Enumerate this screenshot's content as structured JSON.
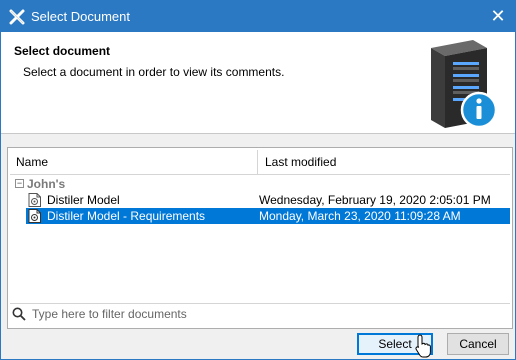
{
  "window": {
    "title": "Select Document",
    "close_glyph": "✕"
  },
  "header": {
    "title": "Select document",
    "description": "Select a document in order to view its comments."
  },
  "table": {
    "columns": [
      "Name",
      "Last modified"
    ],
    "group": {
      "label": "John's",
      "expander_glyph": "−"
    },
    "rows": [
      {
        "name": "Distiler Model",
        "modified": "Wednesday, February 19, 2020 2:05:01 PM",
        "selected": false
      },
      {
        "name": "Distiler Model - Requirements",
        "modified": "Monday, March 23, 2020 11:09:28 AM",
        "selected": true
      }
    ]
  },
  "search": {
    "placeholder": "Type here to filter documents",
    "value": ""
  },
  "buttons": {
    "select": "Select",
    "cancel": "Cancel"
  },
  "colors": {
    "titlebar": "#2b79c2",
    "selection": "#0078d7",
    "info_badge": "#1a8fd8"
  }
}
